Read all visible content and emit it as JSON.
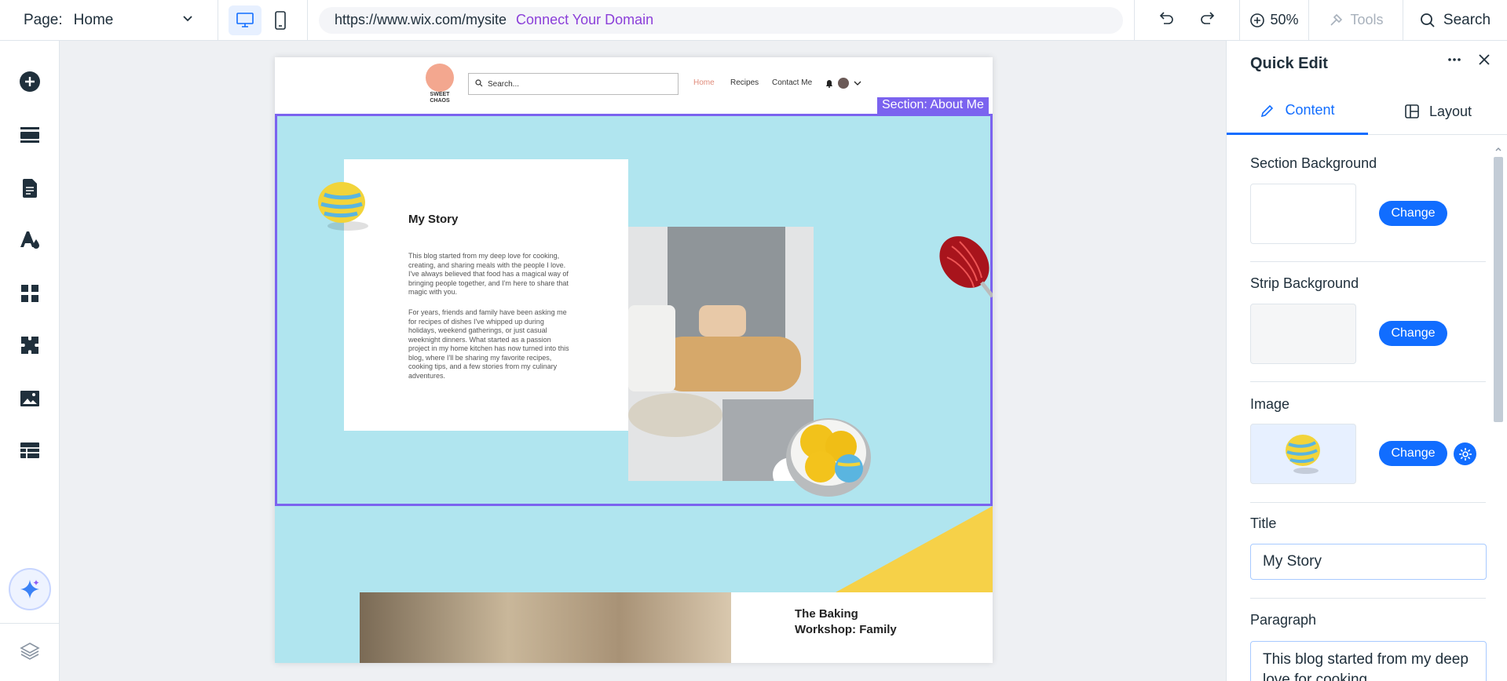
{
  "topbar": {
    "page_label": "Page:",
    "page_value": "Home",
    "url": "https://www.wix.com/mysite",
    "connect_domain": "Connect Your Domain",
    "zoom": "50%",
    "tools": "Tools",
    "search": "Search"
  },
  "site": {
    "logo_text": "SWEET CHAOS",
    "search_placeholder": "Search...",
    "nav": [
      "Home",
      "Recipes",
      "Contact Me"
    ],
    "section_tag": "Section: About Me",
    "story_title": "My Story",
    "story_p1": "This blog started from my deep love for cooking, creating, and sharing meals with the people I love. I've always believed that food has a magical way of bringing people together, and I'm here to share that magic with you.",
    "story_p2": "For years, friends and family have been asking me for recipes of dishes I've whipped up during holidays, weekend gatherings, or just casual weeknight dinners. What started as a passion project in my home kitchen has now turned into this blog, where I'll be sharing my favorite recipes, cooking tips, and a few stories from my culinary adventures.",
    "section2_title": "The Baking Workshop: Family"
  },
  "panel": {
    "title": "Quick Edit",
    "tab_content": "Content",
    "tab_layout": "Layout",
    "section_bg_label": "Section Background",
    "strip_bg_label": "Strip Background",
    "image_label": "Image",
    "change_label": "Change",
    "title_label": "Title",
    "title_value": "My Story",
    "paragraph_label": "Paragraph",
    "paragraph_value": "This blog started from my deep love for cooking"
  },
  "colors": {
    "accent": "#116dff",
    "section_highlight": "#7b63ef",
    "site_bg": "#b0e5ef",
    "domain_link": "#8b3fd9"
  },
  "icons": {
    "left_toolbar": [
      "add-icon",
      "sections-icon",
      "pages-icon",
      "design-icon",
      "apps-icon",
      "business-icon",
      "media-icon",
      "cms-icon",
      "ai-assistant-icon",
      "layers-icon"
    ]
  }
}
